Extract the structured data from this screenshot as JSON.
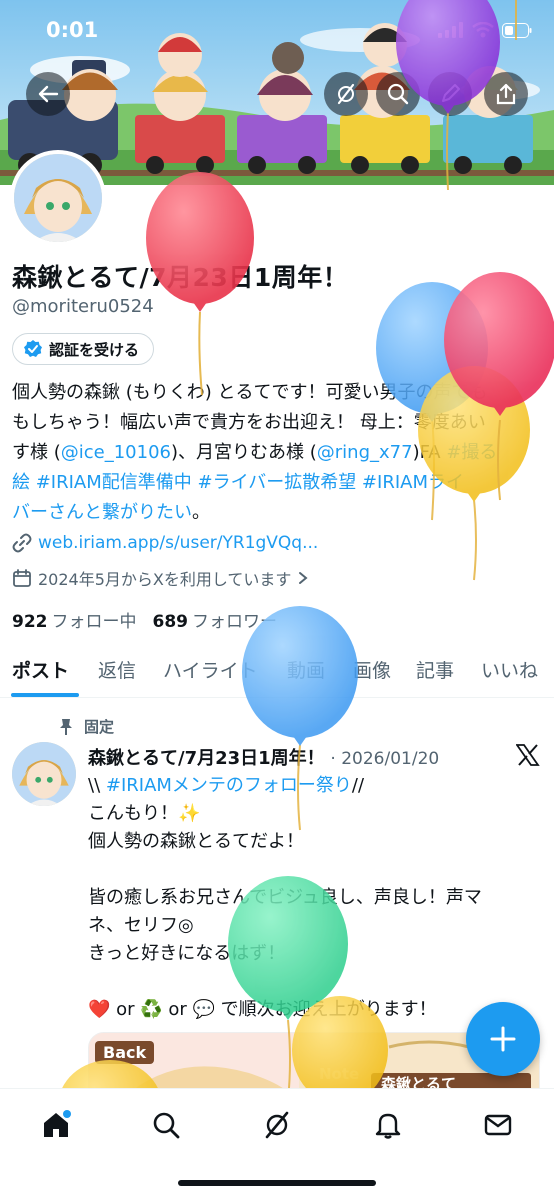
{
  "status_bar": {
    "time": "0:01"
  },
  "profile": {
    "display_name": "森鍬とるて/7月23日1周年！",
    "handle": "@moriteru0524",
    "verify_label": "認証を受ける",
    "bio": {
      "line1": "個人勢の森鍬 (もりくわ) とるてです！可愛い男子の声でも",
      "line2": "もしちゃう！幅広い声で貴方をお出迎え！ 母上：零度あい",
      "line3_a": "す様 (",
      "line3_link": "@ice_10106",
      "line3_b": ")、月宮りむあ様 (",
      "line3_link2": "@ring_x77",
      "line3_c": ")FA ",
      "line3_tag": "#撮る",
      "line4_tags": "絵 #IRIAM配信準備中 #ライバー拡散希望 #IRIAMライ",
      "line5_tag": "バーさんと繋がりたい",
      "line5_end": "。"
    },
    "website": "web.iriam.app/s/user/YR1gVQq...",
    "joined": "2024年5月からXを利用しています",
    "following_count": "922",
    "following_label": "フォロー中",
    "followers_count": "689",
    "followers_label": "フォロワー"
  },
  "tabs": [
    "ポスト",
    "返信",
    "ハイライト",
    "動画",
    "画像",
    "記事",
    "いいね"
  ],
  "pinned_post": {
    "pinned_label": "固定",
    "author": "森鍬とるて/7月23日1周年！",
    "date": "· 2026/01/20",
    "lines": {
      "l1_a": "\\\\ ",
      "l1_tag": "#IRIAMメンテのフォロー祭り",
      "l1_b": "//",
      "l2": "こんもり！✨",
      "l3": "個人勢の森鍬とるてだよ！",
      "l4": "",
      "l5": "皆の癒し系お兄さんでビジュ良し、声良し！声マ",
      "l6": "ネ、セリフ◎",
      "l7": "きっと好きになるはず！",
      "l8": "",
      "l9": "❤️ or ♻️ or 💬 で順次お迎え上がります！"
    },
    "media": {
      "back_label": "Back",
      "note_label": "Note",
      "title": "森鍬とるて"
    }
  },
  "colors": {
    "accent": "#1d9bf0",
    "text": "#0f1419",
    "secondary": "#536471"
  },
  "icons": {
    "header": [
      "back-arrow-icon",
      "grok-icon",
      "search-icon",
      "compose-icon",
      "share-icon"
    ],
    "bottom_nav": [
      "home-icon",
      "search-icon",
      "grok-icon",
      "notifications-icon",
      "messages-icon"
    ]
  }
}
